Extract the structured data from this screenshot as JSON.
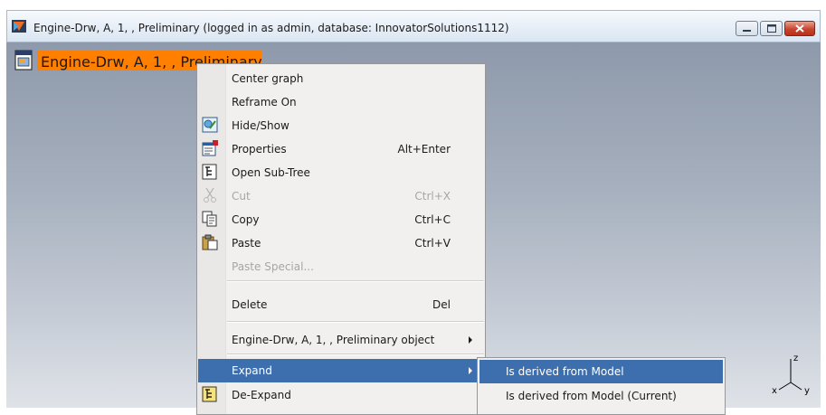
{
  "window": {
    "title": "Engine-Drw, A, 1, , Preliminary (logged in as admin, database: InnovatorSolutions1112)",
    "buttons": [
      "minimize",
      "maximize",
      "close"
    ]
  },
  "graph": {
    "node_label": "Engine-Drw, A, 1, , Preliminary",
    "axes": {
      "z": "z",
      "x": "x",
      "y": "y"
    }
  },
  "context_menu": {
    "items": [
      {
        "label": "Center graph",
        "shortcut": "",
        "enabled": true,
        "icon": ""
      },
      {
        "label": "Reframe On",
        "shortcut": "",
        "enabled": true,
        "icon": ""
      },
      {
        "label": "Hide/Show",
        "shortcut": "",
        "enabled": true,
        "icon": "hide-show-icon"
      },
      {
        "label": "Properties",
        "shortcut": "Alt+Enter",
        "enabled": true,
        "icon": "properties-icon"
      },
      {
        "label": "Open Sub-Tree",
        "shortcut": "",
        "enabled": true,
        "icon": "open-subtree-icon"
      },
      {
        "label": "Cut",
        "shortcut": "Ctrl+X",
        "enabled": false,
        "icon": "scissors-icon"
      },
      {
        "label": "Copy",
        "shortcut": "Ctrl+C",
        "enabled": true,
        "icon": "copy-icon"
      },
      {
        "label": "Paste",
        "shortcut": "Ctrl+V",
        "enabled": true,
        "icon": "paste-icon"
      },
      {
        "label": "Paste Special...",
        "shortcut": "",
        "enabled": false,
        "icon": ""
      },
      {
        "label": "Delete",
        "shortcut": "Del",
        "enabled": true,
        "icon": ""
      },
      {
        "label": "Engine-Drw, A, 1, , Preliminary object",
        "shortcut": "",
        "enabled": true,
        "icon": "",
        "submenu": true
      },
      {
        "label": "Expand",
        "shortcut": "",
        "enabled": true,
        "icon": "",
        "submenu": true,
        "highlighted": true
      },
      {
        "label": "De-Expand",
        "shortcut": "",
        "enabled": true,
        "icon": "de-expand-icon"
      }
    ]
  },
  "submenu": {
    "items": [
      {
        "label": "Is derived from Model",
        "highlighted": true
      },
      {
        "label": "Is derived from Model (Current)",
        "highlighted": false
      }
    ]
  },
  "colors": {
    "node_highlight": "#ff7f00",
    "menu_highlight": "#3d6fae",
    "menu_background": "#f1f0ef"
  }
}
